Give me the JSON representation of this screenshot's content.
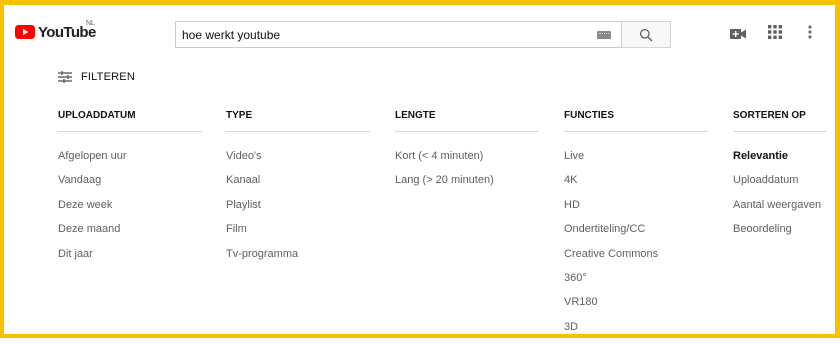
{
  "brand": {
    "name": "YouTube",
    "country": "NL"
  },
  "search": {
    "query": "hoe werkt youtube"
  },
  "filter_toggle": {
    "label": "FILTEREN"
  },
  "filters": [
    {
      "header": "UPLOADDATUM",
      "items": [
        "Afgelopen uur",
        "Vandaag",
        "Deze week",
        "Deze maand",
        "Dit jaar"
      ]
    },
    {
      "header": "TYPE",
      "items": [
        "Video's",
        "Kanaal",
        "Playlist",
        "Film",
        "Tv-programma"
      ]
    },
    {
      "header": "LENGTE",
      "items": [
        "Kort (< 4 minuten)",
        "Lang (> 20 minuten)"
      ]
    },
    {
      "header": "FUNCTIES",
      "items": [
        "Live",
        "4K",
        "HD",
        "Ondertiteling/CC",
        "Creative Commons",
        "360°",
        "VR180",
        "3D"
      ]
    },
    {
      "header": "SORTEREN OP",
      "items": [
        "Relevantie",
        "Uploaddatum",
        "Aantal weergaven",
        "Beoordeling"
      ],
      "selected": "Relevantie"
    }
  ],
  "colors": {
    "brand_red": "#ff0000",
    "frame": "#f7c100",
    "muted_text": "#606060"
  }
}
